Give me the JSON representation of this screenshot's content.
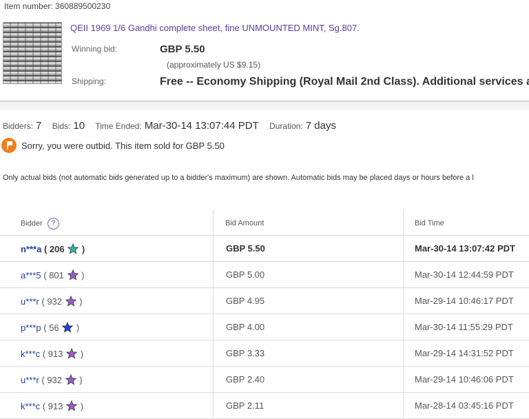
{
  "item": {
    "number_label": "Item number:",
    "number": "360889500230",
    "title": "QEII 1969 1/6 Gandhi complete sheet, fine UNMOUNTED MINT, Sg.807.",
    "winning_bid_label": "Winning bid:",
    "winning_bid": "GBP 5.50",
    "approx": "(approximately US $9.15)",
    "shipping_label": "Shipping:",
    "shipping": "Free -- Economy Shipping (Royal Mail 2nd Class).  Additional services a"
  },
  "stats": {
    "bidders_label": "Bidders:",
    "bidders": "7",
    "bids_label": "Bids:",
    "bids": "10",
    "time_ended_label": "Time Ended:",
    "time_ended": "Mar-30-14 13:07:44 PDT",
    "duration_label": "Duration:",
    "duration": "7 days"
  },
  "status": {
    "message": "Sorry, you were outbid. This item sold for GBP 5.50",
    "color": "#ef7d1a"
  },
  "note": "Only actual bids (not automatic bids generated up to a bidder's maximum) are shown. Automatic bids may be placed days or hours before a l",
  "table": {
    "headers": {
      "bidder": "Bidder",
      "help": "?",
      "amount": "Bid Amount",
      "time": "Bid Time"
    },
    "rows": [
      {
        "name": "n***a",
        "feedback": "206",
        "star_color": "#2bb5a0",
        "amount": "GBP 5.50",
        "time": "Mar-30-14 13:07:42 PDT",
        "winner": true
      },
      {
        "name": "a***5",
        "feedback": "801",
        "star_color": "#9b59c9",
        "amount": "GBP 5.00",
        "time": "Mar-30-14 12:44:59 PDT",
        "winner": false
      },
      {
        "name": "u***r",
        "feedback": "932",
        "star_color": "#9b59c9",
        "amount": "GBP 4.95",
        "time": "Mar-29-14 10:46:17 PDT",
        "winner": false
      },
      {
        "name": "p***p",
        "feedback": "56",
        "star_color": "#1f3fd1",
        "amount": "GBP 4.00",
        "time": "Mar-30-14 11:55:29 PDT",
        "winner": false
      },
      {
        "name": "k***c",
        "feedback": "913",
        "star_color": "#9b59c9",
        "amount": "GBP 3.33",
        "time": "Mar-29-14 14:31:52 PDT",
        "winner": false
      },
      {
        "name": "u***r",
        "feedback": "932",
        "star_color": "#9b59c9",
        "amount": "GBP 2.40",
        "time": "Mar-29-14 10:46:06 PDT",
        "winner": false
      },
      {
        "name": "k***c",
        "feedback": "913",
        "star_color": "#9b59c9",
        "amount": "GBP 2.11",
        "time": "Mar-28-14 03:45:16 PDT",
        "winner": false
      }
    ]
  }
}
